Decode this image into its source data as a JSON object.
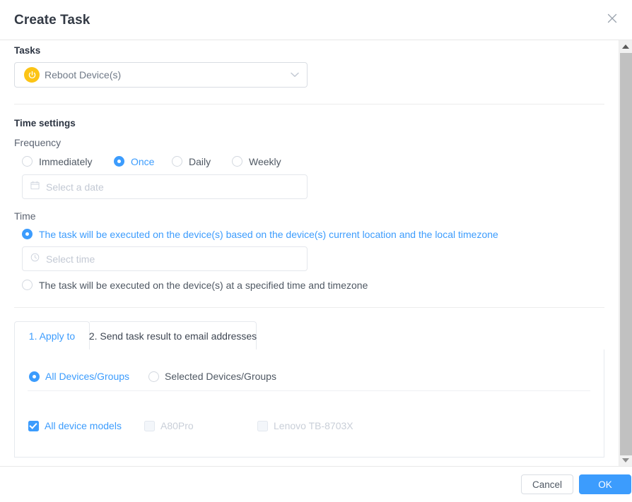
{
  "header": {
    "title": "Create Task",
    "close_icon": "close-icon"
  },
  "tasks_section": {
    "label": "Tasks",
    "select": {
      "value": "Reboot Device(s)",
      "icon": "power-icon",
      "chevron": "chevron-down-icon"
    }
  },
  "time_settings": {
    "label": "Time settings",
    "frequency": {
      "label": "Frequency",
      "options": [
        {
          "label": "Immediately",
          "selected": false
        },
        {
          "label": "Once",
          "selected": true
        },
        {
          "label": "Daily",
          "selected": false
        },
        {
          "label": "Weekly",
          "selected": false
        }
      ],
      "date_input": {
        "placeholder": "Select a date",
        "value": "",
        "icon": "calendar-icon"
      }
    },
    "time": {
      "label": "Time",
      "options": [
        {
          "label": "The task will be executed on the device(s) based on the device(s) current location and the local timezone",
          "selected": true
        },
        {
          "label": "The task will be executed on the device(s) at a specified time and timezone",
          "selected": false
        }
      ],
      "time_input": {
        "placeholder": "Select time",
        "value": "",
        "icon": "clock-icon"
      }
    }
  },
  "tabs": {
    "items": [
      {
        "label": "1. Apply to",
        "active": true
      },
      {
        "label": "2. Send task result to email addresses",
        "active": false
      }
    ],
    "apply_to": {
      "scope_options": [
        {
          "label": "All Devices/Groups",
          "selected": true
        },
        {
          "label": "Selected Devices/Groups",
          "selected": false
        }
      ],
      "model_options": [
        {
          "label": "All device models",
          "checked": true,
          "disabled": false
        },
        {
          "label": "A80Pro",
          "checked": false,
          "disabled": true
        },
        {
          "label": "Lenovo TB-8703X",
          "checked": false,
          "disabled": true
        }
      ]
    }
  },
  "footer": {
    "cancel_label": "Cancel",
    "ok_label": "OK"
  },
  "colors": {
    "accent": "#3c9cfd",
    "power_icon": "#fcc415",
    "text": "#4f5863",
    "border": "#d9dde3"
  }
}
